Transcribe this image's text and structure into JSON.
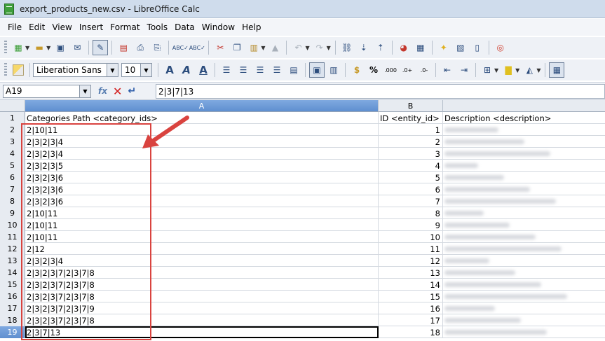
{
  "window": {
    "title": "export_products_new.csv - LibreOffice Calc"
  },
  "menu": [
    "File",
    "Edit",
    "View",
    "Insert",
    "Format",
    "Tools",
    "Data",
    "Window",
    "Help"
  ],
  "toolbar": {
    "font_name": "Liberation Sans",
    "font_size": "10",
    "icons": [
      "new-icon",
      "open-icon",
      "save-icon",
      "email-icon",
      "edit-mode-icon",
      "pdf-icon",
      "print-icon",
      "print-preview-icon",
      "spellcheck-icon",
      "autospell-icon",
      "cut-icon",
      "copy-icon",
      "paste-icon",
      "clone-format-icon",
      "undo-icon",
      "redo-icon",
      "hyperlink-icon",
      "sort-ascending-icon",
      "sort-descending-icon",
      "chart-icon",
      "pivot-icon",
      "gallery-icon",
      "navigator-icon",
      "datasource-icon",
      "help-icon"
    ]
  },
  "formula": {
    "cell_ref": "A19",
    "content": "2|3|7|13"
  },
  "columns": [
    "A",
    "B"
  ],
  "rows": [
    {
      "n": "1",
      "a": "Categories Path <category_ids>",
      "b": "ID <entity_id>",
      "c": "Description <description>",
      "bText": true
    },
    {
      "n": "2",
      "a": "2|10|11",
      "b": "1"
    },
    {
      "n": "3",
      "a": "2|3|2|3|4",
      "b": "2"
    },
    {
      "n": "4",
      "a": "2|3|2|3|4",
      "b": "3"
    },
    {
      "n": "5",
      "a": "2|3|2|3|5",
      "b": "4"
    },
    {
      "n": "6",
      "a": "2|3|2|3|6",
      "b": "5"
    },
    {
      "n": "7",
      "a": "2|3|2|3|6",
      "b": "6"
    },
    {
      "n": "8",
      "a": "2|3|2|3|6",
      "b": "7"
    },
    {
      "n": "9",
      "a": "2|10|11",
      "b": "8"
    },
    {
      "n": "10",
      "a": "2|10|11",
      "b": "9"
    },
    {
      "n": "11",
      "a": "2|10|11",
      "b": "10"
    },
    {
      "n": "12",
      "a": "2|12",
      "b": "11"
    },
    {
      "n": "13",
      "a": "2|3|2|3|4",
      "b": "12"
    },
    {
      "n": "14",
      "a": "2|3|2|3|7|2|3|7|8",
      "b": "13"
    },
    {
      "n": "15",
      "a": "2|3|2|3|7|2|3|7|8",
      "b": "14"
    },
    {
      "n": "16",
      "a": "2|3|2|3|7|2|3|7|8",
      "b": "15"
    },
    {
      "n": "17",
      "a": "2|3|2|3|7|2|3|7|9",
      "b": "16"
    },
    {
      "n": "18",
      "a": "2|3|2|3|7|2|3|7|8",
      "b": "17"
    },
    {
      "n": "19",
      "a": "2|3|7|13",
      "b": "18"
    }
  ],
  "colors": {
    "highlight": "#d9433f",
    "selected_header": "#5f8fd0"
  }
}
